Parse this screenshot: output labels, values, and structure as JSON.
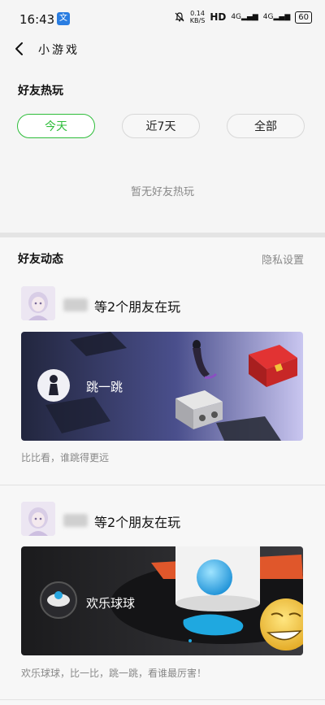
{
  "status_bar": {
    "time": "16:43",
    "app_badge": "文",
    "speed_value": "0.14",
    "speed_unit": "KB/S",
    "hd": "HD",
    "signal_1": "4G",
    "signal_2": "4G",
    "battery": "60"
  },
  "nav": {
    "title": "小游戏"
  },
  "friends_hot": {
    "title": "好友热玩",
    "tabs": [
      {
        "label": "今天",
        "active": true
      },
      {
        "label": "近7天",
        "active": false
      },
      {
        "label": "全部",
        "active": false
      }
    ],
    "empty_text": "暂无好友热玩"
  },
  "friend_activity": {
    "title": "好友动态",
    "privacy_label": "隐私设置",
    "items": [
      {
        "friends_text": "等2个朋友在玩",
        "game_name": "跳一跳",
        "description": "比比看，谁跳得更远"
      },
      {
        "friends_text": "等2个朋友在玩",
        "game_name": "欢乐球球",
        "description": "欢乐球球，比一比，跳一跳，看谁最厉害！"
      }
    ]
  },
  "colors": {
    "accent_green": "#2ebd3a",
    "page_background": "#f5f5f5",
    "muted_text": "#888888"
  }
}
